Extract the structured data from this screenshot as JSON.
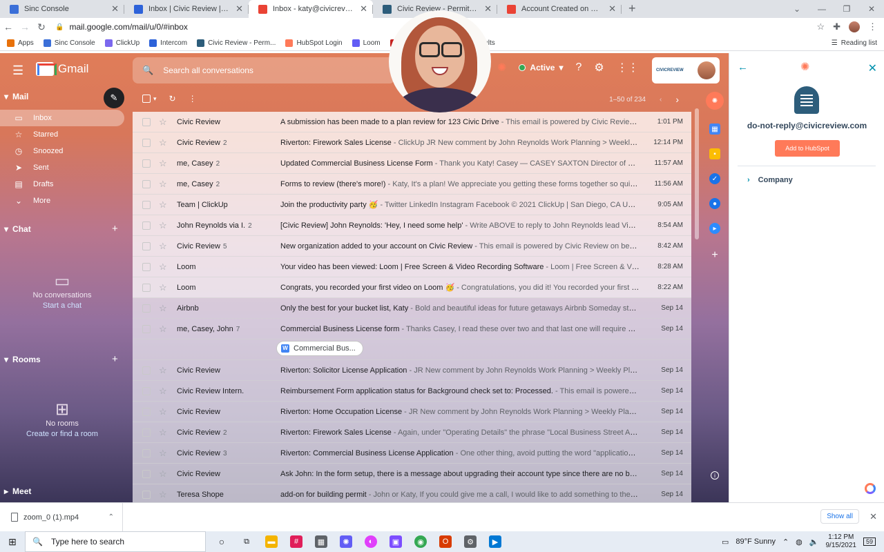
{
  "browser": {
    "tabs": [
      {
        "title": "Sinc Console",
        "color": "#3b6fd8",
        "active": false
      },
      {
        "title": "Inbox | Civic Review | Intercom",
        "color": "#2d62d9",
        "active": false
      },
      {
        "title": "Inbox - katy@civicreview.com - C",
        "color": "#ea4335",
        "active": true
      },
      {
        "title": "Civic Review - Permit & Licensing",
        "color": "#2d5d7b",
        "active": false
      },
      {
        "title": "Account Created on Civic Review",
        "color": "#ea4335",
        "active": false
      }
    ],
    "new_tab": "+",
    "url": "mail.google.com/mail/u/0/#inbox",
    "bookmarks": [
      {
        "label": "Apps",
        "color": "#e8710a"
      },
      {
        "label": "Sinc Console",
        "color": "#3b6fd8"
      },
      {
        "label": "ClickUp",
        "color": "#7b68ee"
      },
      {
        "label": "Intercom",
        "color": "#2d62d9"
      },
      {
        "label": "Civic Review - Perm...",
        "color": "#2d5d7b"
      },
      {
        "label": "HubSpot Login",
        "color": "#ff7a59"
      },
      {
        "label": "Loom",
        "color": "#625df5"
      },
      {
        "label": "mySU",
        "color": "#c5221f"
      },
      {
        "label": "GoodHire Results",
        "color": "#34a853"
      }
    ],
    "reading_list": "Reading list"
  },
  "gmail": {
    "brand": "Gmail",
    "search_placeholder": "Search all conversations",
    "status": "Active",
    "brand_small": "CIVICREVIEW",
    "nav": {
      "mail_header": "Mail",
      "items": [
        {
          "label": "Inbox",
          "icon": "inbox-icon",
          "selected": true
        },
        {
          "label": "Starred",
          "icon": "star-icon"
        },
        {
          "label": "Snoozed",
          "icon": "clock-icon"
        },
        {
          "label": "Sent",
          "icon": "send-icon"
        },
        {
          "label": "Drafts",
          "icon": "draft-icon"
        },
        {
          "label": "More",
          "icon": "chevron-down-icon"
        }
      ],
      "chat_header": "Chat",
      "chat_empty": "No conversations",
      "chat_link": "Start a chat",
      "rooms_header": "Rooms",
      "rooms_empty": "No rooms",
      "rooms_link": "Create or find a room",
      "meet_header": "Meet"
    },
    "pagination": "1–50 of 234",
    "emails": [
      {
        "from": "Civic Review",
        "count": "",
        "subject": "A submission has been made to a plan review for 123 Civic Drive",
        "snippet": " - This email is powered by Civic Review o...",
        "time": "1:01 PM",
        "read": false
      },
      {
        "from": "Civic Review",
        "count": "2",
        "subject": "Riverton: Firework Sales License",
        "snippet": " - ClickUp JR New comment by John Reynolds Work Planning > Weekly Pla...",
        "time": "12:14 PM",
        "read": false
      },
      {
        "from": "me, Casey",
        "count": "2",
        "subject": "Updated Commercial Business License Form",
        "snippet": " - Thank you Katy! Casey — CASEY SAXTON Director of Comm...",
        "time": "11:57 AM",
        "read": false
      },
      {
        "from": "me, Casey",
        "count": "2",
        "subject": "Forms to review (there's more!)",
        "snippet": " - Katy, It's a plan! We appreciate you getting these forms together so quickl...",
        "time": "11:56 AM",
        "read": false
      },
      {
        "from": "Team | ClickUp",
        "count": "",
        "subject": "Join the productivity party 🥳",
        "snippet": " - Twitter LinkedIn Instagram Facebook © 2021 ClickUp | San Diego, CA Unsu...",
        "time": "9:05 AM",
        "read": false
      },
      {
        "from": "John Reynolds via I.",
        "count": "2",
        "subject": "[Civic Review] John Reynolds: 'Hey, I need some help'",
        "snippet": " - Write ABOVE to reply to John Reynolds lead View co...",
        "time": "8:54 AM",
        "read": false
      },
      {
        "from": "Civic Review",
        "count": "5",
        "subject": "New organization added to your account on Civic Review",
        "snippet": " - This email is powered by Civic Review on behalf ...",
        "time": "8:42 AM",
        "read": false
      },
      {
        "from": "Loom",
        "count": "",
        "subject": "Your video has been viewed: Loom | Free Screen & Video Recording Software",
        "snippet": " - Loom | Free Screen & Video ...",
        "time": "8:28 AM",
        "read": false
      },
      {
        "from": "Loom",
        "count": "",
        "subject": "Congrats, you recorded your first video on Loom 🥳",
        "snippet": " - Congratulations, you did it! You recorded your first vid...",
        "time": "8:22 AM",
        "read": false
      },
      {
        "from": "Airbnb",
        "count": "",
        "subject": "Only the best for your bucket list, Katy",
        "snippet": " - Bold and beautiful ideas for future getaways Airbnb Someday start...",
        "time": "Sep 14",
        "read": true
      },
      {
        "from": "me, Casey, John",
        "count": "7",
        "subject": "Commercial Business License form",
        "snippet": " - Thanks Casey, I read these over two and that last one will require a so...",
        "time": "Sep 14",
        "read": true
      }
    ],
    "attachment_chip": "Commercial Bus...",
    "emails_more": [
      {
        "from": "Civic Review",
        "count": "",
        "subject": "Riverton: Solicitor License Application",
        "snippet": " - JR New comment by John Reynolds Work Planning > Weekly Planni...",
        "time": "Sep 14",
        "read": true
      },
      {
        "from": "Civic Review Intern.",
        "count": "",
        "subject": "Reimbursement Form application status for Background check set to: Processed.",
        "snippet": " - This email is powered b...",
        "time": "Sep 14",
        "read": true
      },
      {
        "from": "Civic Review",
        "count": "",
        "subject": "Riverton: Home Occupation License",
        "snippet": " - JR New comment by John Reynolds Work Planning > Weekly Plannin...",
        "time": "Sep 14",
        "read": true
      },
      {
        "from": "Civic Review",
        "count": "2",
        "subject": "Riverton: Firework Sales License",
        "snippet": " - Again, under \"Operating Details\" the phrase \"Local Business Street Addre...",
        "time": "Sep 14",
        "read": true
      },
      {
        "from": "Civic Review",
        "count": "3",
        "subject": "Riverton: Commercial Business License Application",
        "snippet": " - One other thing, avoid putting the word \"application\" i...",
        "time": "Sep 14",
        "read": true
      },
      {
        "from": "Civic Review",
        "count": "",
        "subject": "Ask John: In the form setup, there is a message about upgrading their account type since there are no base...",
        "snippet": "",
        "time": "Sep 14",
        "read": true
      },
      {
        "from": "Teresa Shope",
        "count": "",
        "subject": "add-on for building permit",
        "snippet": " - John or Katy, If you could give me a call, I would like to add something to the b...",
        "time": "Sep 14",
        "read": true
      }
    ]
  },
  "hubspot": {
    "email": "do-not-reply@civicreview.com",
    "add_button": "Add to HubSpot",
    "company_label": "Company"
  },
  "download": {
    "file": "zoom_0 (1).mp4",
    "show_all": "Show all"
  },
  "taskbar": {
    "search_placeholder": "Type here to search",
    "weather": "89°F  Sunny",
    "time": "1:12 PM",
    "date": "9/15/2021",
    "notifications": "59"
  }
}
